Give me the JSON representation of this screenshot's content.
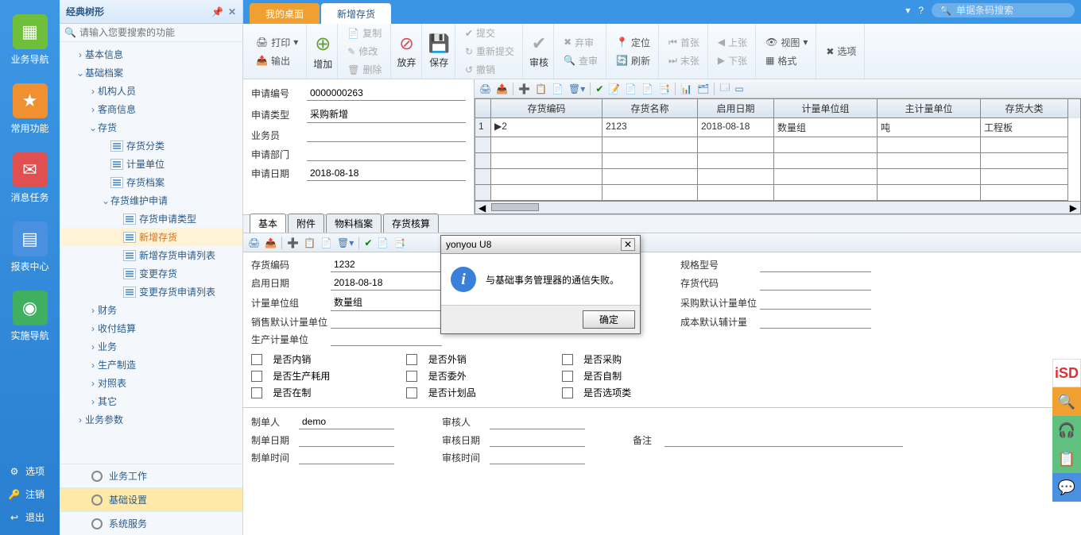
{
  "dock": {
    "items": [
      {
        "label": "业务导航",
        "color": "#6fbf3a"
      },
      {
        "label": "常用功能",
        "color": "#f09030"
      },
      {
        "label": "消息任务",
        "color": "#e05050"
      },
      {
        "label": "报表中心",
        "color": "#4a90e0"
      },
      {
        "label": "实施导航",
        "color": "#40b060"
      }
    ],
    "bottom": [
      {
        "label": "选项",
        "glyph": "⚙"
      },
      {
        "label": "注销",
        "glyph": "🔑"
      },
      {
        "label": "退出",
        "glyph": "↩"
      }
    ]
  },
  "sidebar": {
    "title": "经典树形",
    "search_placeholder": "请输入您要搜索的功能",
    "nodes": [
      {
        "text": "基本信息",
        "tw": "›",
        "ind": 1
      },
      {
        "text": "基础档案",
        "tw": "⌄",
        "ind": 1
      },
      {
        "text": "机构人员",
        "tw": "›",
        "ind": 2
      },
      {
        "text": "客商信息",
        "tw": "›",
        "ind": 2
      },
      {
        "text": "存货",
        "tw": "⌄",
        "ind": 2
      },
      {
        "text": "存货分类",
        "doc": true,
        "ind": 3
      },
      {
        "text": "计量单位",
        "doc": true,
        "ind": 3
      },
      {
        "text": "存货档案",
        "doc": true,
        "ind": 3
      },
      {
        "text": "存货维护申请",
        "tw": "⌄",
        "ind": 3
      },
      {
        "text": "存货申请类型",
        "doc": true,
        "ind": 4
      },
      {
        "text": "新增存货",
        "doc": true,
        "ind": 4,
        "orange": true
      },
      {
        "text": "新增存货申请列表",
        "doc": true,
        "ind": 4
      },
      {
        "text": "变更存货",
        "doc": true,
        "ind": 4
      },
      {
        "text": "变更存货申请列表",
        "doc": true,
        "ind": 4
      },
      {
        "text": "财务",
        "tw": "›",
        "ind": 2
      },
      {
        "text": "收付结算",
        "tw": "›",
        "ind": 2
      },
      {
        "text": "业务",
        "tw": "›",
        "ind": 2
      },
      {
        "text": "生产制造",
        "tw": "›",
        "ind": 2
      },
      {
        "text": "对照表",
        "tw": "›",
        "ind": 2
      },
      {
        "text": "其它",
        "tw": "›",
        "ind": 2
      },
      {
        "text": "业务参数",
        "tw": "›",
        "ind": 1
      }
    ],
    "bottom_items": [
      "业务工作",
      "基础设置",
      "系统服务"
    ]
  },
  "tabs": {
    "home": "我的桌面",
    "active": "新增存货"
  },
  "topsearch_placeholder": "单据条码搜索",
  "ribbon": {
    "print": "打印",
    "output": "输出",
    "add": "增加",
    "copy": "复制",
    "modify": "修改",
    "delete": "删除",
    "abandon": "放弃",
    "save": "保存",
    "submit": "提交",
    "resubmit": "重新提交",
    "unsubmit": "撤销",
    "audit": "审核",
    "unapprove": "弃审",
    "refresh": "刷新",
    "locate": "定位",
    "lookup": "查审",
    "first": "首张",
    "last": "末张",
    "prev": "上张",
    "next": "下张",
    "view": "视图",
    "format": "格式",
    "options": "选项"
  },
  "form": {
    "apply_no_label": "申请编号",
    "apply_no": "0000000263",
    "apply_type_label": "申请类型",
    "apply_type": "采购新增",
    "salesman_label": "业务员",
    "salesman": "",
    "dept_label": "申请部门",
    "dept": "",
    "apply_date_label": "申请日期",
    "apply_date": "2018-08-18"
  },
  "grid": {
    "headers": [
      "存货编码",
      "存货名称",
      "启用日期",
      "计量单位组",
      "主计量单位",
      "存货大类"
    ],
    "row": {
      "idx": "1",
      "code": "2",
      "name": "2123",
      "date": "2018-08-18",
      "unit": "数量组",
      "munit": "吨",
      "cat": "工程板"
    }
  },
  "subtabs": [
    "基本",
    "附件",
    "物料档案",
    "存货核算"
  ],
  "detail": {
    "code_label": "存货编码",
    "code": "1232",
    "enable_label": "启用日期",
    "enable": "2018-08-18",
    "unit_label": "计量单位组",
    "unit": "数量组",
    "sale_unit_label": "销售默认计量单位",
    "prod_unit_label": "生产计量单位",
    "spec_label": "规格型号",
    "invcode_label": "存货代码",
    "pur_unit_label": "采购默认计量单位",
    "cost_unit_label": "成本默认辅计量",
    "chk1": "是否内销",
    "chk2": "是否外销",
    "chk3": "是否采购",
    "chk4": "是否生产耗用",
    "chk5": "是否委外",
    "chk6": "是否自制",
    "chk7": "是否在制",
    "chk8": "是否计划品",
    "chk9": "是否选项类"
  },
  "footer": {
    "maker_label": "制单人",
    "maker": "demo",
    "auditor_label": "审核人",
    "make_date_label": "制单日期",
    "audit_date_label": "审核日期",
    "remark_label": "备注",
    "make_time_label": "制单时间",
    "audit_time_label": "审核时间"
  },
  "dialog": {
    "title": "yonyou U8",
    "message": "与基础事务管理器的通信失败。",
    "ok": "确定"
  }
}
